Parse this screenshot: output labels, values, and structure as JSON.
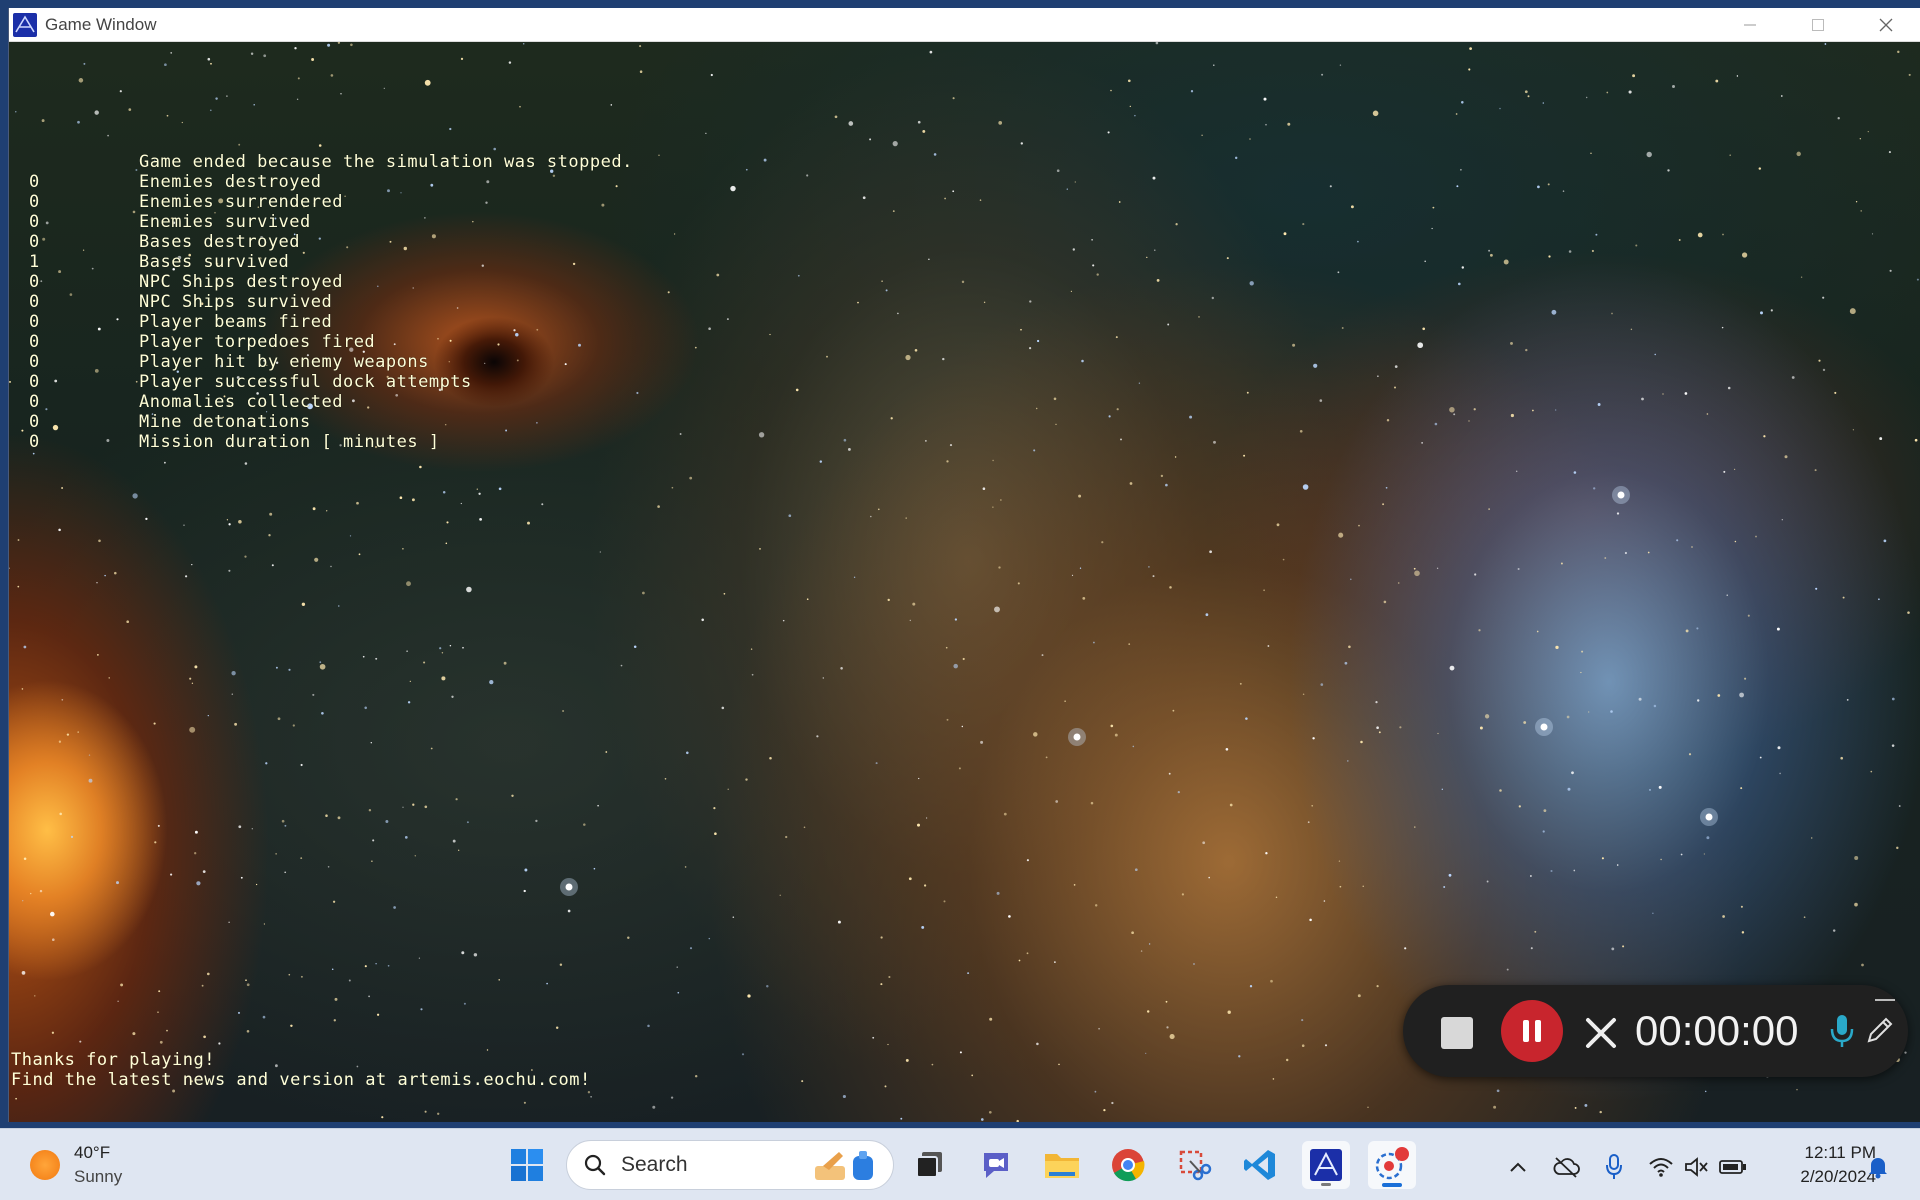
{
  "window": {
    "title": "Game Window"
  },
  "game": {
    "header": "Game ended because the simulation was stopped.",
    "stats": [
      {
        "value": "0",
        "label": "Enemies destroyed"
      },
      {
        "value": "0",
        "label": "Enemies surrendered"
      },
      {
        "value": "0",
        "label": "Enemies survived"
      },
      {
        "value": "0",
        "label": "Bases destroyed"
      },
      {
        "value": "1",
        "label": "Bases survived"
      },
      {
        "value": "0",
        "label": "NPC Ships destroyed"
      },
      {
        "value": "0",
        "label": "NPC Ships survived"
      },
      {
        "value": "0",
        "label": "Player beams fired"
      },
      {
        "value": "0",
        "label": "Player torpedoes fired"
      },
      {
        "value": "0",
        "label": "Player hit by enemy weapons"
      },
      {
        "value": "0",
        "label": "Player successful dock attempts"
      },
      {
        "value": "0",
        "label": "Anomalies collected"
      },
      {
        "value": "0",
        "label": "Mine detonations"
      },
      {
        "value": "0",
        "label": "Mission duration [ minutes ]"
      }
    ],
    "footer_line1": "Thanks for playing!",
    "footer_line2": "Find the latest news and version at artemis.eochu.com!"
  },
  "recorder": {
    "time": "00:00:00"
  },
  "taskbar": {
    "weather_temp": "40°F",
    "weather_desc": "Sunny",
    "search_label": "Search",
    "time": "12:11 PM",
    "date": "2/20/2024"
  },
  "colors": {
    "text_yellow": "#ffffd8",
    "record_red": "#c8252d",
    "accent_blue": "#1a6fd8"
  }
}
